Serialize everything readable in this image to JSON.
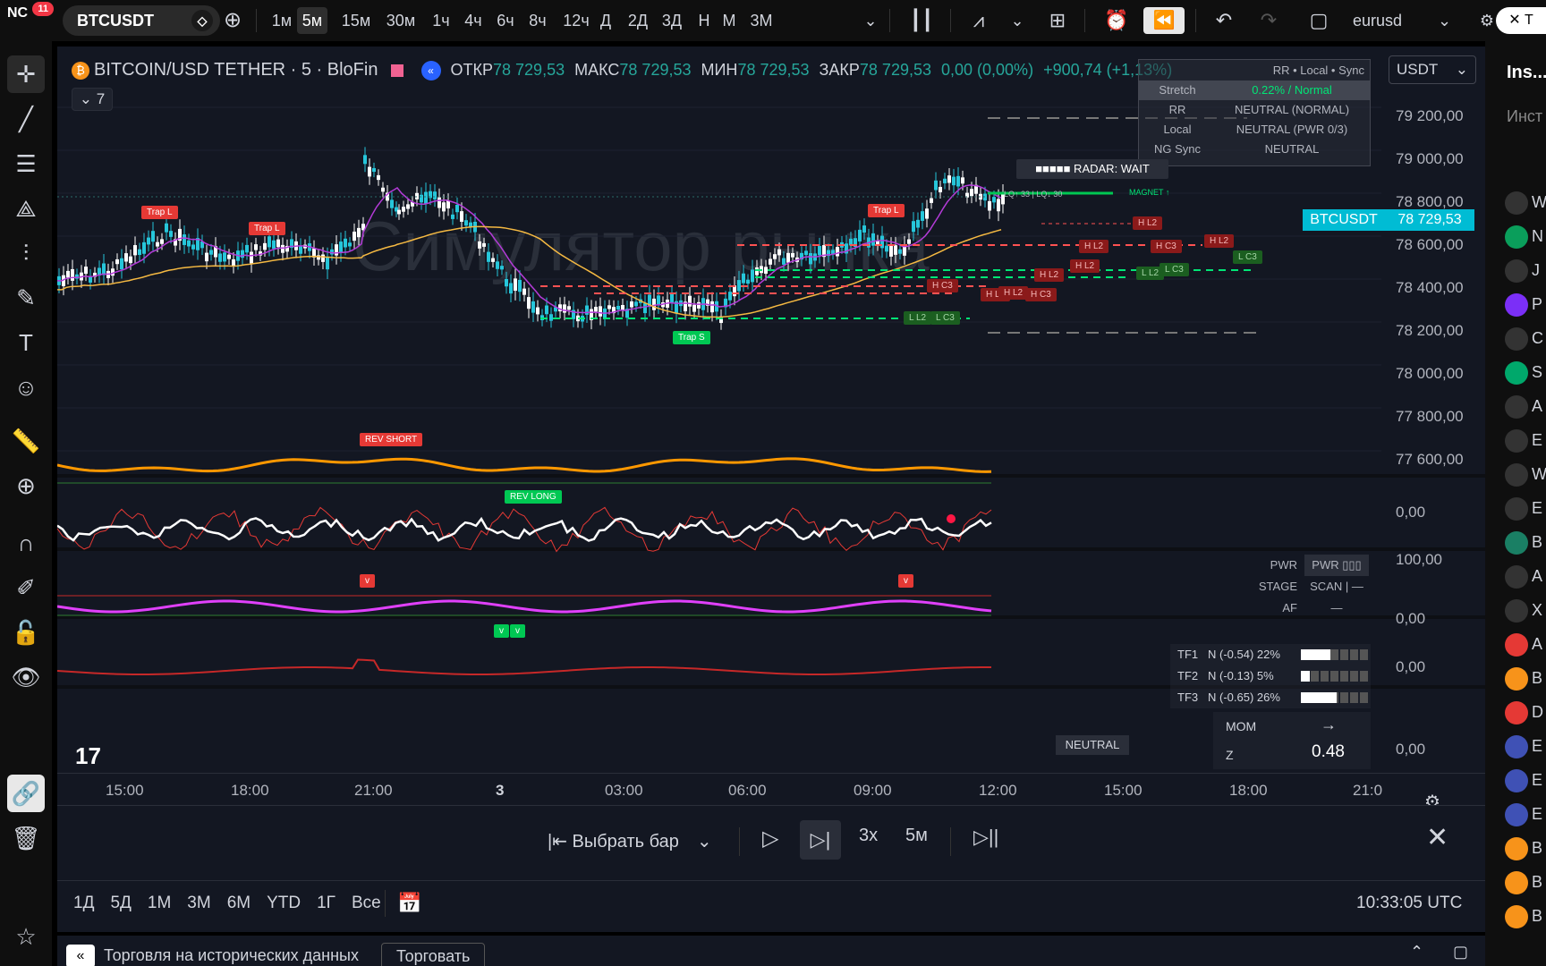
{
  "topbar": {
    "logo": "NC",
    "notif_count": "11",
    "symbol": "BTCUSDT",
    "timeframes": [
      "1м",
      "5м",
      "15м",
      "30м",
      "1ч",
      "4ч",
      "6ч",
      "8ч",
      "12ч",
      "Д",
      "2Д",
      "3Д",
      "Н",
      "М",
      "3М"
    ],
    "active_timeframe": "5м",
    "watchlist": "eurusd"
  },
  "legend": {
    "title": "BITCOIN/USD TETHER · 5 · BloFin",
    "open_label": "ОТКР",
    "open": "78 729,53",
    "high_label": "МАКС",
    "high": "78 729,53",
    "low_label": "МИН",
    "low": "78 729,53",
    "close_label": "ЗАКР",
    "close": "78 729,53",
    "change": "0,00 (0,00%)",
    "change2": "+900,74 (+1,13%)",
    "indicators_count": "7"
  },
  "currency": "USDT",
  "info_table": {
    "header": "RR • Local • Sync",
    "rows": [
      {
        "k": "Stretch",
        "v": "0.22% / Normal"
      },
      {
        "k": "RR",
        "v": "NEUTRAL (NORMAL)"
      },
      {
        "k": "Local",
        "v": "NEUTRAL (PWR 0/3)"
      },
      {
        "k": "NG Sync",
        "v": "NEUTRAL"
      }
    ]
  },
  "radar": "■■■■■ RADAR: WAIT",
  "price_tag": {
    "symbol": "BTCUSDT",
    "price": "78 729,53"
  },
  "price_labels": [
    "79 200,00",
    "79 000,00",
    "78 800,00",
    "78 600,00",
    "78 400,00",
    "78 200,00",
    "78 000,00",
    "77 800,00",
    "77 600,00"
  ],
  "osc_labels": {
    "p1": "0,00",
    "p2_top": "100,00",
    "p2_bot": "0,00",
    "p3": "0,00",
    "p4": "0,00"
  },
  "watermark": "Симулятор рынка",
  "signals": {
    "trap_l": "Trap L",
    "trap_s": "Trap S",
    "rev_short": "REV SHORT",
    "rev_long": "REV LONG",
    "h_l2": "H L2",
    "h_c3": "H C3",
    "l_l2": "L L2",
    "l_c3": "L C3",
    "magnet": "MAGNET ↑",
    "lq": "LQ↑ 33 | LQ↓ 30",
    "v": "v",
    "neutral": "NEUTRAL"
  },
  "pwr_table": {
    "rows": [
      {
        "k": "PWR",
        "v": "PWR ▯▯▯"
      },
      {
        "k": "STAGE",
        "v": "SCAN | —"
      },
      {
        "k": "AF",
        "v": "—"
      }
    ]
  },
  "tf_table": {
    "rows": [
      {
        "k": "TF1",
        "v": "N (-0.54) 22%",
        "fill": 0.22
      },
      {
        "k": "TF2",
        "v": "N (-0.13) 5%",
        "fill": 0.05
      },
      {
        "k": "TF3",
        "v": "N (-0.65) 26%",
        "fill": 0.26
      }
    ]
  },
  "mom_table": {
    "mom": "MOM",
    "mom_v": "→",
    "z": "Z",
    "z_v": "0.48"
  },
  "time_labels": [
    "15:00",
    "18:00",
    "21:00",
    "3",
    "03:00",
    "06:00",
    "09:00",
    "12:00",
    "15:00",
    "18:00",
    "21:0"
  ],
  "replay": {
    "select_bar": "Выбрать бар",
    "speed": "3x",
    "interval": "5м"
  },
  "ranges": [
    "1Д",
    "5Д",
    "1М",
    "3М",
    "6М",
    "YTD",
    "1Г",
    "Все"
  ],
  "clock": "10:33:05 UTC",
  "footer": {
    "label": "Торговля на исторических данных",
    "trade_btn": "Торговать"
  },
  "right_panel": {
    "title": "Ins...",
    "sub": "Инст",
    "item_letters": [
      "W",
      "N",
      "J",
      "P",
      "C",
      "S",
      "A",
      "E",
      "W",
      "E",
      "B",
      "A",
      "X",
      "A",
      "B",
      "D",
      "E",
      "E",
      "E",
      "B",
      "B",
      "B"
    ]
  }
}
